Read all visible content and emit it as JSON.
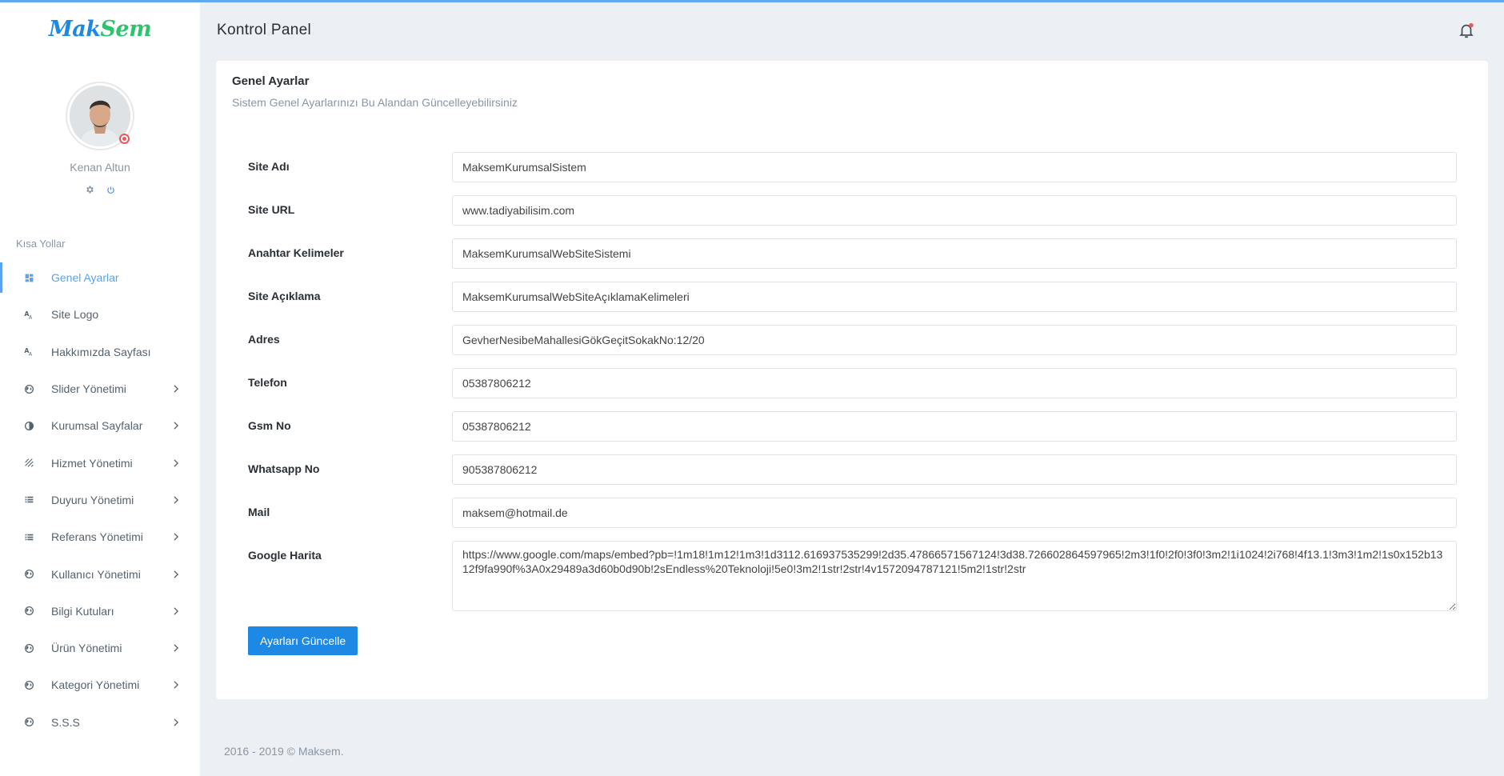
{
  "brand": {
    "part1": "Mak",
    "part2": "Sem"
  },
  "user": {
    "name": "Kenan Altun",
    "avatar_alt": "avatar"
  },
  "header": {
    "title": "Kontrol Panel"
  },
  "sidebar": {
    "section_title": "Kısa Yollar",
    "items": [
      {
        "label": "Genel Ayarlar",
        "icon": "dashboard-icon",
        "active": true,
        "submenu": false
      },
      {
        "label": "Site Logo",
        "icon": "text-format-icon",
        "active": false,
        "submenu": false
      },
      {
        "label": "Hakkımızda Sayfası",
        "icon": "text-format-icon",
        "active": false,
        "submenu": false
      },
      {
        "label": "Slider Yönetimi",
        "icon": "globe-icon",
        "active": false,
        "submenu": true
      },
      {
        "label": "Kurumsal Sayfalar",
        "icon": "contrast-icon",
        "active": false,
        "submenu": true
      },
      {
        "label": "Hizmet Yönetimi",
        "icon": "texture-icon",
        "active": false,
        "submenu": true
      },
      {
        "label": "Duyuru Yönetimi",
        "icon": "list-icon",
        "active": false,
        "submenu": true
      },
      {
        "label": "Referans Yönetimi",
        "icon": "list-icon",
        "active": false,
        "submenu": true
      },
      {
        "label": "Kullanıcı Yönetimi",
        "icon": "globe-icon",
        "active": false,
        "submenu": true
      },
      {
        "label": "Bilgi Kutuları",
        "icon": "globe-icon",
        "active": false,
        "submenu": true
      },
      {
        "label": "Ürün Yönetimi",
        "icon": "globe-icon",
        "active": false,
        "submenu": true
      },
      {
        "label": "Kategori Yönetimi",
        "icon": "globe-icon",
        "active": false,
        "submenu": true
      },
      {
        "label": "S.S.S",
        "icon": "globe-icon",
        "active": false,
        "submenu": true
      }
    ]
  },
  "card": {
    "title": "Genel Ayarlar",
    "subtitle": "Sistem Genel Ayarlarınızı Bu Alandan Güncelleyebilirsiniz"
  },
  "form": {
    "fields": [
      {
        "label": "Site Adı",
        "value": "Maksem Kurumsal Sistem"
      },
      {
        "label": "Site URL",
        "value": "www.tadiyabilisim.com"
      },
      {
        "label": "Anahtar Kelimeler",
        "value": "Maksem Kurumsal Web Site Sistemi"
      },
      {
        "label": "Site Açıklama",
        "value": "Maksem Kurumsal Web Site Açıklama Kelimeleri"
      },
      {
        "label": "Adres",
        "value": "Gevher Nesibe Mahallesi Gök Geçit Sokak No:12/20"
      },
      {
        "label": "Telefon",
        "value": "05387806212"
      },
      {
        "label": "Gsm No",
        "value": "05387806212"
      },
      {
        "label": "Whatsapp No",
        "value": "905387806212"
      },
      {
        "label": "Mail",
        "value": "maksem@hotmail.de"
      },
      {
        "label": "Google Harita",
        "value": "https://www.google.com/maps/embed?pb=!1m18!1m12!1m3!1d3112.616937535299!2d35.4786657156712 4!3d38.726602864597965!2m3!1f0!2f0!3f0!3m2!1i1024!2i768!4f13.1!3m3!1m2!1s0x152b1312f9fa990f%3A0x29489a3d60b0d90b!2sEndless%20Teknoloji!5e0!3m2!1str!2str!4v1572094787121!5m2!1str!2str"
      }
    ],
    "submit_label": "Ayarları Güncelle"
  },
  "footer": {
    "text": "2016 - 2019 © Maksem."
  },
  "colors": {
    "accent": "#1e88e5",
    "active_menu": "#5ba3f0",
    "brand_green": "#2ec46e",
    "status_red": "#f2545b",
    "notification_dot": "#f2545b"
  }
}
